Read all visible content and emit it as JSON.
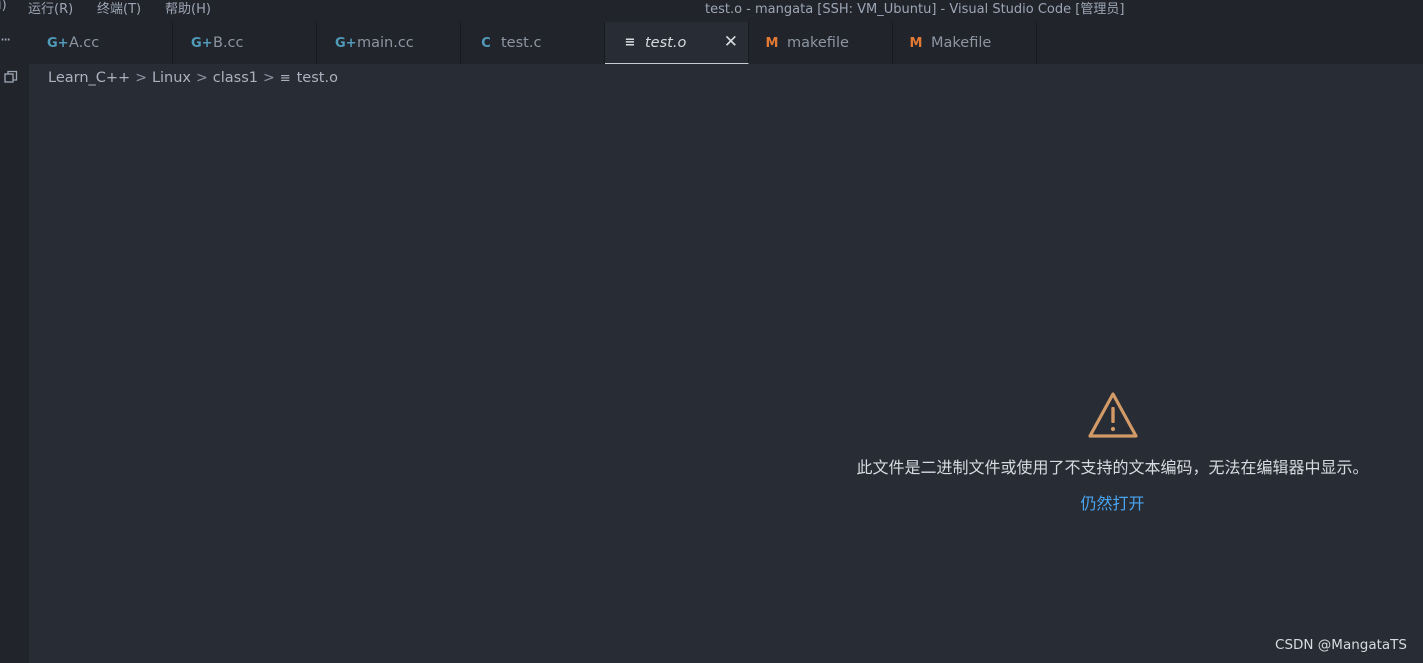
{
  "menu": {
    "partial_item": "i)",
    "items": [
      "运行(R)",
      "终端(T)",
      "帮助(H)"
    ]
  },
  "window": {
    "title": "test.o - mangata [SSH: VM_Ubuntu] - Visual Studio Code [管理员]"
  },
  "tabs": [
    {
      "label": "A.cc",
      "icon": "cpp-icon",
      "icon_glyph": "G+",
      "icon_color": "#519aba"
    },
    {
      "label": "B.cc",
      "icon": "cpp-icon",
      "icon_glyph": "G+",
      "icon_color": "#519aba"
    },
    {
      "label": "main.cc",
      "icon": "cpp-icon",
      "icon_glyph": "G+",
      "icon_color": "#519aba"
    },
    {
      "label": "test.c",
      "icon": "c-icon",
      "icon_glyph": "C",
      "icon_color": "#519aba"
    },
    {
      "label": "test.o",
      "icon": "file-lines-icon",
      "icon_glyph": "≡",
      "icon_color": "#d7dae0",
      "active": true
    },
    {
      "label": "makefile",
      "icon": "makefile-icon",
      "icon_glyph": "M",
      "icon_color": "#e37933"
    },
    {
      "label": "Makefile",
      "icon": "makefile-icon",
      "icon_glyph": "M",
      "icon_color": "#e37933"
    }
  ],
  "tab_close_glyph": "✕",
  "breadcrumb": {
    "items": [
      "Learn_C++",
      "Linux",
      "class1",
      "test.o"
    ],
    "separator": ">",
    "file_icon_glyph": "≡"
  },
  "editor": {
    "warning_message": "此文件是二进制文件或使用了不支持的文本编码，无法在编辑器中显示。",
    "open_anyway_label": "仍然打开",
    "warning_color": "#d19a66"
  },
  "watermark": "CSDN @MangataTS"
}
